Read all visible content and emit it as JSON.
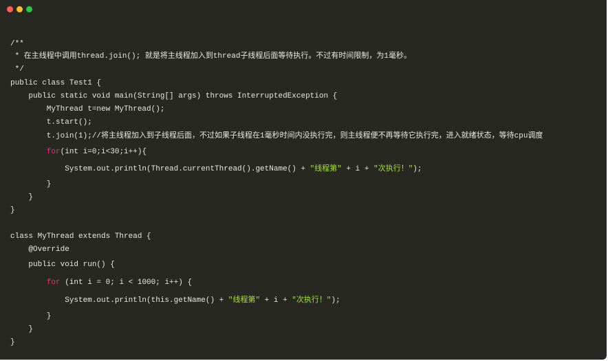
{
  "window": {
    "buttons": [
      {
        "name": "close",
        "color": "#ff5f56"
      },
      {
        "name": "minimize",
        "color": "#ffbd2e"
      },
      {
        "name": "maximize",
        "color": "#27c93f"
      }
    ],
    "background": "#272822"
  },
  "colors": {
    "keyword": "#f92672",
    "string": "#a6e22e",
    "text": "#e8e8e2"
  },
  "code_lines": [
    [
      [
        "/**",
        "cm"
      ]
    ],
    [
      [
        " * 在主线程中调用thread.join(); 就是将主线程加入到thread子线程后面等待执行。不过有时间限制，为1毫秒。",
        "cm"
      ]
    ],
    [
      [
        " */",
        "cm"
      ]
    ],
    [
      [
        "public class Test1 {",
        ""
      ]
    ],
    [
      [
        "    public static void main(String[] args) throws InterruptedException {",
        ""
      ]
    ],
    [
      [
        "        MyThread t=new MyThread();",
        ""
      ]
    ],
    [
      [
        "        t.start();",
        ""
      ]
    ],
    [
      [
        "        t.join(1);//将主线程加入到子线程后面，不过如果子线程在1毫秒时间内没执行完，则主线程便不再等待它执行完，进入就绪状态，等待cpu调度",
        ""
      ]
    ],
    [
      [
        "        ",
        ""
      ],
      [
        "for",
        "kw-red"
      ],
      [
        "(int i=0;i<30;i++){",
        ""
      ]
    ],
    [
      [
        "            System.out.println(Thread.currentThread().getName() + ",
        ""
      ],
      [
        "\"线程第\"",
        "str"
      ],
      [
        " + i + ",
        ""
      ],
      [
        "\"次执行！\"",
        "str"
      ],
      [
        ");",
        ""
      ]
    ],
    [
      [
        "        }",
        ""
      ]
    ],
    [
      [
        "    }",
        ""
      ]
    ],
    [
      [
        "}",
        ""
      ]
    ],
    [
      [
        "",
        ""
      ]
    ],
    [
      [
        "class MyThread extends Thread {",
        ""
      ]
    ],
    [
      [
        "    @Override",
        ""
      ]
    ],
    [
      [
        "    public void run() {",
        ""
      ]
    ],
    [
      [
        "        ",
        ""
      ],
      [
        "for",
        "kw-red"
      ],
      [
        " (int i = 0; i < 1000; i++) {",
        ""
      ]
    ],
    [
      [
        "            System.out.println(this.getName() + ",
        ""
      ],
      [
        "\"线程第\"",
        "str"
      ],
      [
        " + i + ",
        ""
      ],
      [
        "\"次执行！\"",
        "str"
      ],
      [
        ");",
        ""
      ]
    ],
    [
      [
        "        }",
        ""
      ]
    ],
    [
      [
        "    }",
        ""
      ]
    ],
    [
      [
        "}",
        ""
      ]
    ]
  ]
}
